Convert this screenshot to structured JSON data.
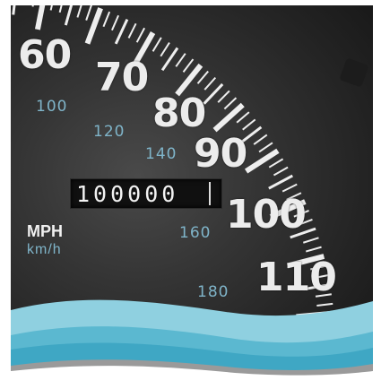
{
  "mph_labels": [
    "60",
    "70",
    "80",
    "90",
    "100",
    "110"
  ],
  "kmh_labels": [
    "100",
    "120",
    "140",
    "160",
    "180"
  ],
  "odometer": "100000",
  "unit_mph": "MPH",
  "unit_kmh": "km/h",
  "colors": {
    "dial": "#2e2e2e",
    "mph_text": "#ececec",
    "kmh_text": "#7fb4c9",
    "wave_light": "#8fd0e0",
    "wave_mid": "#5bb8d0",
    "wave_dark": "#3fa7c4",
    "wave_gray": "#9a9a9a"
  }
}
